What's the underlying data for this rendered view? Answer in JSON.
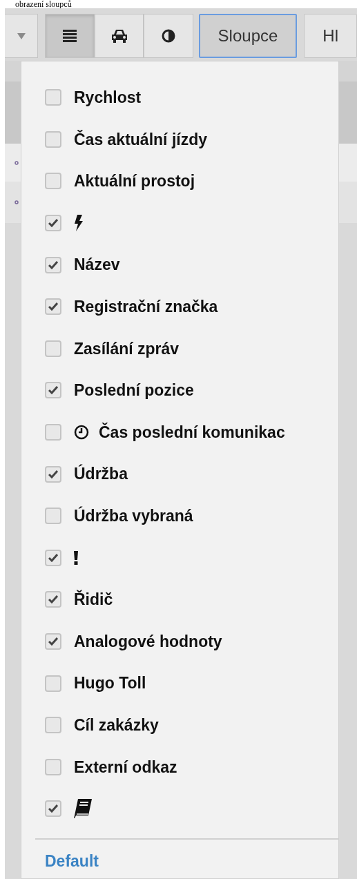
{
  "caption": "obrazení sloupců",
  "toolbar": {
    "buttons": [
      {
        "kind": "caret",
        "selected": false
      },
      {
        "kind": "list",
        "selected": true
      },
      {
        "kind": "car",
        "selected": false
      },
      {
        "kind": "contrast",
        "selected": false
      },
      {
        "kind": "text",
        "label": "Sloupce",
        "focused": true
      },
      {
        "kind": "text",
        "label": "Hl",
        "focused": false
      }
    ]
  },
  "menu": {
    "items": [
      {
        "kind": "text",
        "label": "Rychlost",
        "checked": false
      },
      {
        "kind": "text",
        "label": "Čas aktuální jízdy",
        "checked": false
      },
      {
        "kind": "text",
        "label": "Aktuální prostoj",
        "checked": false
      },
      {
        "kind": "bolt",
        "checked": true
      },
      {
        "kind": "text",
        "label": "Název",
        "checked": true
      },
      {
        "kind": "text",
        "label": "Registrační značka",
        "checked": true
      },
      {
        "kind": "text",
        "label": "Zasílání zpráv",
        "checked": false
      },
      {
        "kind": "text",
        "label": "Poslední pozice",
        "checked": true
      },
      {
        "kind": "clock",
        "label": "Čas poslední komunikac",
        "checked": false
      },
      {
        "kind": "text",
        "label": "Údržba",
        "checked": true
      },
      {
        "kind": "text",
        "label": "Údržba vybraná",
        "checked": false
      },
      {
        "kind": "exclamation",
        "checked": true
      },
      {
        "kind": "text",
        "label": "Řidič",
        "checked": true
      },
      {
        "kind": "text",
        "label": "Analogové hodnoty",
        "checked": true
      },
      {
        "kind": "text",
        "label": "Hugo Toll",
        "checked": false
      },
      {
        "kind": "text",
        "label": "Cíl zakázky",
        "checked": false
      },
      {
        "kind": "text",
        "label": "Externí odkaz",
        "checked": false
      },
      {
        "kind": "book",
        "checked": true
      }
    ],
    "footer_link": "Default"
  }
}
